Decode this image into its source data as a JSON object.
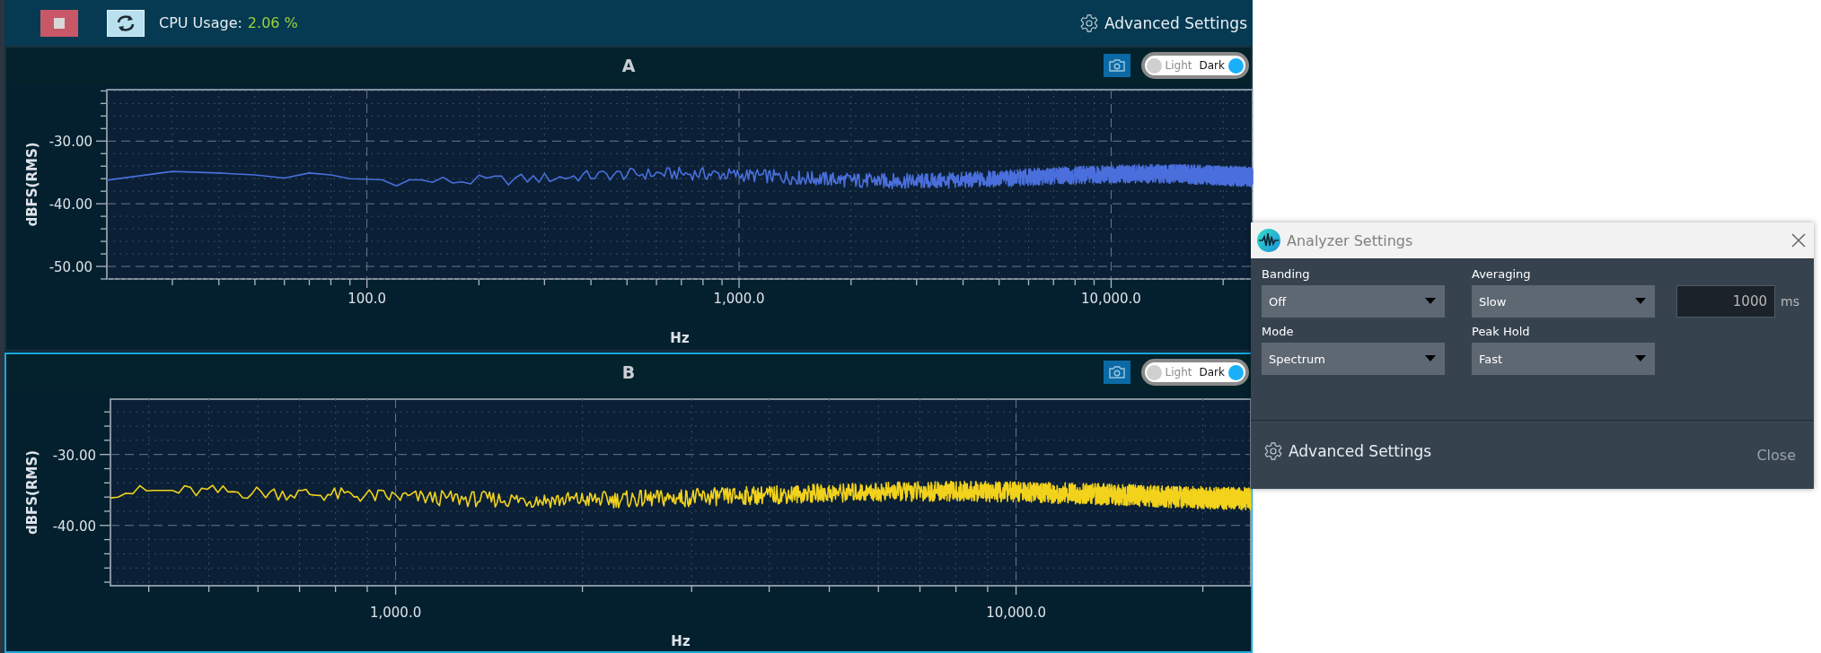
{
  "toolbar": {
    "cpu_label": "CPU Usage:",
    "cpu_value": "2.06 %",
    "advanced_settings": "Advanced Settings"
  },
  "charts": [
    {
      "title": "A",
      "selected": false,
      "color": "#4a6fdc",
      "xlabel": "Hz",
      "ylabel": "dBFS(RMS)",
      "xticks": [
        "100.0",
        "1,000.0",
        "10,000.0"
      ],
      "yticks": [
        "-30.00",
        "-40.00",
        "-50.00"
      ],
      "theme_options": [
        {
          "label": "Light",
          "selected": false
        },
        {
          "label": "Dark",
          "selected": true
        }
      ]
    },
    {
      "title": "B",
      "selected": true,
      "color": "#f2d21b",
      "xlabel": "Hz",
      "ylabel": "dBFS(RMS)",
      "xticks": [
        "1,000.0",
        "10,000.0"
      ],
      "yticks": [
        "-30.00",
        "-40.00"
      ],
      "theme_options": [
        {
          "label": "Light",
          "selected": false
        },
        {
          "label": "Dark",
          "selected": true
        }
      ]
    }
  ],
  "dialog": {
    "title": "Analyzer Settings",
    "fields": [
      {
        "kind": "dropdown",
        "label": "Banding",
        "value": "Off"
      },
      {
        "kind": "dropdown",
        "label": "Averaging",
        "value": "Slow"
      },
      {
        "kind": "number",
        "value": "1000",
        "unit": "ms"
      },
      {
        "kind": "dropdown",
        "label": "Mode",
        "value": "Spectrum"
      },
      {
        "kind": "dropdown",
        "label": "Peak Hold",
        "value": "Fast"
      }
    ],
    "advanced_settings": "Advanced Settings",
    "close": "Close"
  }
}
